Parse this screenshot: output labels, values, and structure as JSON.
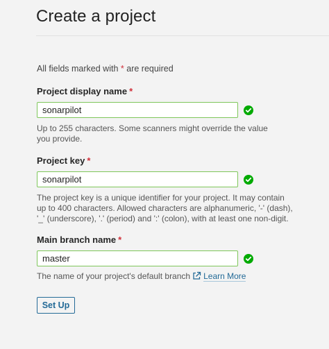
{
  "page": {
    "title": "Create a project"
  },
  "form": {
    "required_note_prefix": "All fields marked with",
    "required_note_asterisk": "*",
    "required_note_suffix": "are required",
    "fields": {
      "display_name": {
        "label": "Project display name",
        "required_mark": "*",
        "value": "sonarpilot",
        "help": "Up to 255 characters. Some scanners might override the value you provide.",
        "valid_icon": "check-circle-icon"
      },
      "project_key": {
        "label": "Project key",
        "required_mark": "*",
        "value": "sonarpilot",
        "help": "The project key is a unique identifier for your project. It may contain up to 400 characters. Allowed characters are alphanumeric, '-' (dash), '_' (underscore), '.' (period) and ':' (colon), with at least one non-digit.",
        "valid_icon": "check-circle-icon"
      },
      "main_branch": {
        "label": "Main branch name",
        "required_mark": "*",
        "value": "master",
        "help": "The name of your project's default branch",
        "learn_more": "Learn More",
        "link_icon": "external-link-icon",
        "valid_icon": "check-circle-icon"
      }
    },
    "submit_label": "Set Up"
  },
  "colors": {
    "valid_border": "#7ec65a",
    "valid_icon": "#00aa00",
    "required_asterisk": "#d02f3a",
    "link": "#236a97",
    "background": "#f3f3f3"
  }
}
